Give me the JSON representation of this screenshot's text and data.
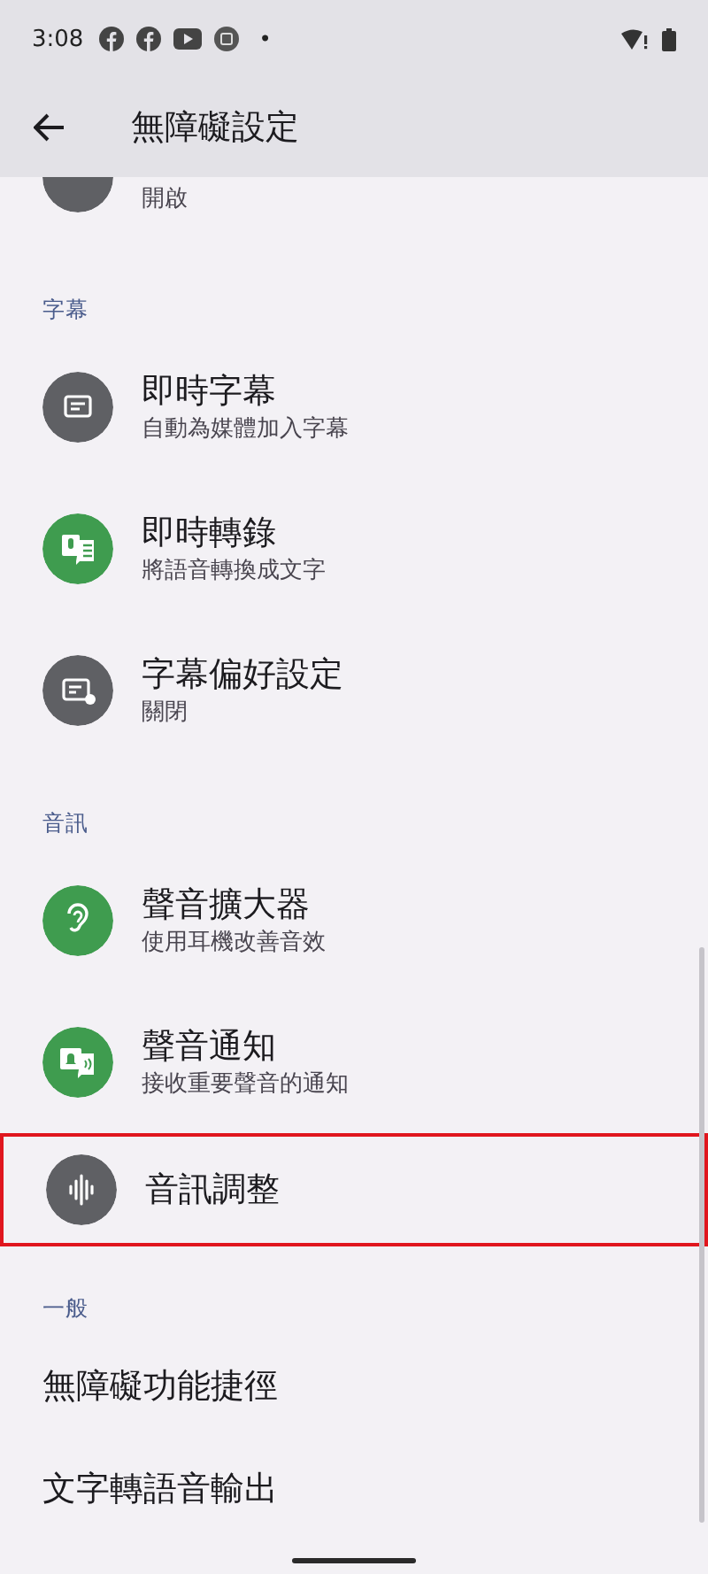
{
  "status_bar": {
    "time": "3:08",
    "dot": "•"
  },
  "app_bar": {
    "title": "無障礙設定"
  },
  "sections": [
    {
      "items": [
        {
          "subtitle": "開啟",
          "kind": "partial",
          "highlighted": false
        }
      ]
    },
    {
      "header": "字幕",
      "items": [
        {
          "title": "即時字幕",
          "subtitle": "自動為媒體加入字幕",
          "kind": "captions",
          "highlighted": false
        },
        {
          "title": "即時轉錄",
          "subtitle": "將語音轉換成文字",
          "kind": "transcribe",
          "highlighted": false
        },
        {
          "title": "字幕偏好設定",
          "subtitle": "關閉",
          "kind": "caption-settings",
          "highlighted": false
        }
      ]
    },
    {
      "header": "音訊",
      "items": [
        {
          "title": "聲音擴大器",
          "subtitle": "使用耳機改善音效",
          "kind": "ear",
          "highlighted": false
        },
        {
          "title": "聲音通知",
          "subtitle": "接收重要聲音的通知",
          "kind": "notify",
          "highlighted": false
        },
        {
          "title": "音訊調整",
          "kind": "audio",
          "highlighted": true
        }
      ]
    },
    {
      "header": "一般",
      "items": [
        {
          "title": "無障礙功能捷徑",
          "kind": "plain",
          "highlighted": false
        },
        {
          "title": "文字轉語音輸出",
          "kind": "plain",
          "highlighted": false
        }
      ]
    }
  ]
}
